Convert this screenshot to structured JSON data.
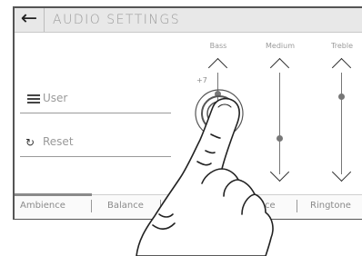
{
  "title": "AUDIO SETTINGS",
  "back_icon": "←",
  "menu": [
    {
      "label": "User",
      "icon": "list-icon"
    },
    {
      "label": "Reset",
      "icon": "reset-icon",
      "glyph": "↻"
    }
  ],
  "eq": {
    "bands": [
      {
        "name": "Bass",
        "value": "+7"
      },
      {
        "name": "Medium",
        "value": ""
      },
      {
        "name": "Treble",
        "value": ""
      }
    ]
  },
  "tabs": [
    "Ambience",
    "Balance",
    "",
    "Voice",
    "Ringtone"
  ],
  "colors": {
    "title_bar": "#e8e8e8",
    "frame": "#555555",
    "text": "#9a9a9a"
  }
}
